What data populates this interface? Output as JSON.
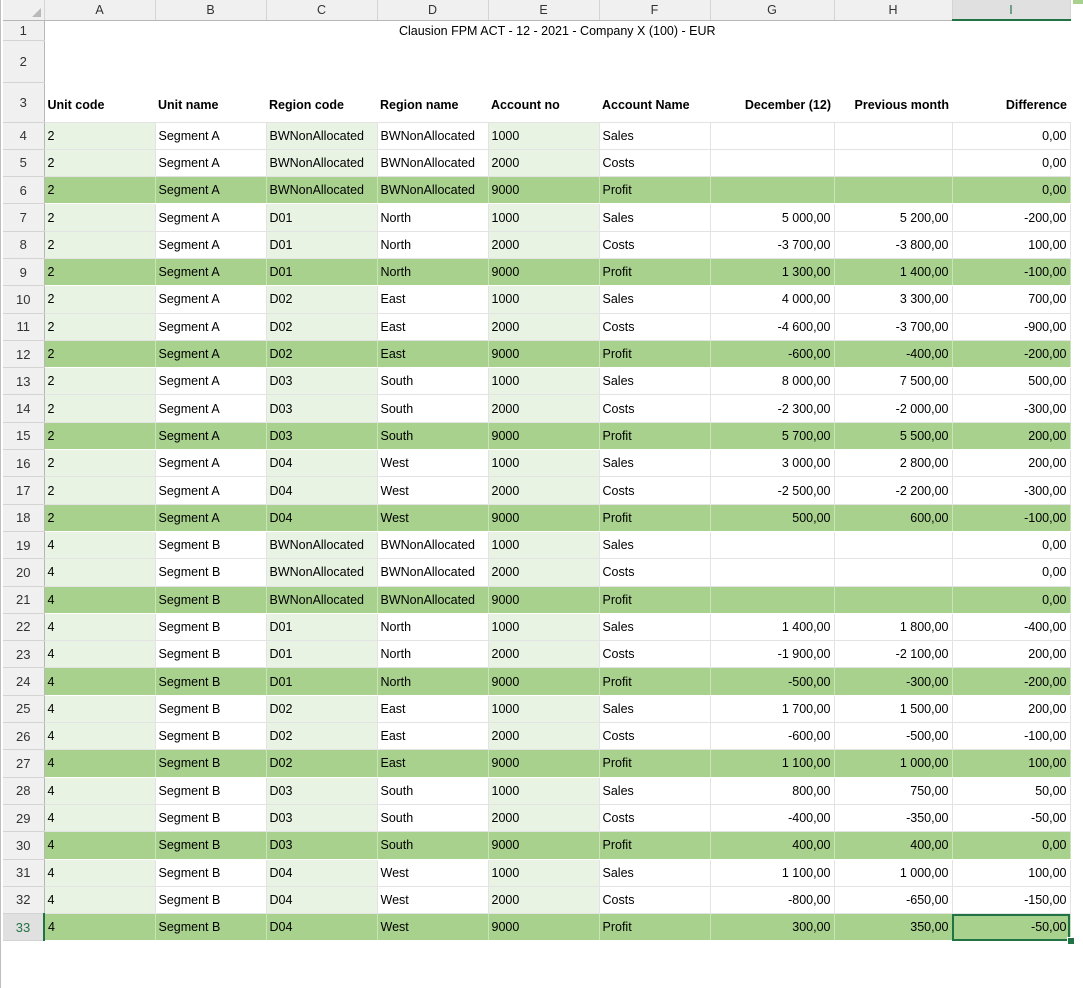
{
  "columns": [
    "A",
    "B",
    "C",
    "D",
    "E",
    "F",
    "G",
    "H",
    "I"
  ],
  "selected_column": "I",
  "selected_row": "33",
  "report_title": "Clausion FPM    ACT - 12 - 2021 - Company X (100) - EUR",
  "headers": {
    "unit_code": "Unit code",
    "unit_name": "Unit name",
    "region_code": "Region code",
    "region_name": "Region name",
    "account_no": "Account no",
    "account_name": "Account Name",
    "current": "December (12)",
    "previous": "Previous month",
    "difference": "Difference"
  },
  "row_numbers": [
    "1",
    "2",
    "3",
    "4",
    "5",
    "6",
    "7",
    "8",
    "9",
    "10",
    "11",
    "12",
    "13",
    "14",
    "15",
    "16",
    "17",
    "18",
    "19",
    "20",
    "21",
    "22",
    "23",
    "24",
    "25",
    "26",
    "27",
    "28",
    "29",
    "30",
    "31",
    "32",
    "33"
  ],
  "rows": [
    {
      "unit_code": "2",
      "unit_name": "Segment A",
      "region_code": "BWNonAllocated",
      "region_name": "BWNonAllocated",
      "account_no": "1000",
      "account_name": "Sales",
      "current": "",
      "previous": "",
      "difference": "0,00"
    },
    {
      "unit_code": "2",
      "unit_name": "Segment A",
      "region_code": "BWNonAllocated",
      "region_name": "BWNonAllocated",
      "account_no": "2000",
      "account_name": "Costs",
      "current": "",
      "previous": "",
      "difference": "0,00"
    },
    {
      "unit_code": "2",
      "unit_name": "Segment A",
      "region_code": "BWNonAllocated",
      "region_name": "BWNonAllocated",
      "account_no": "9000",
      "account_name": "Profit",
      "current": "",
      "previous": "",
      "difference": "0,00"
    },
    {
      "unit_code": "2",
      "unit_name": "Segment A",
      "region_code": "D01",
      "region_name": "North",
      "account_no": "1000",
      "account_name": "Sales",
      "current": "5 000,00",
      "previous": "5 200,00",
      "difference": "-200,00"
    },
    {
      "unit_code": "2",
      "unit_name": "Segment A",
      "region_code": "D01",
      "region_name": "North",
      "account_no": "2000",
      "account_name": "Costs",
      "current": "-3 700,00",
      "previous": "-3 800,00",
      "difference": "100,00"
    },
    {
      "unit_code": "2",
      "unit_name": "Segment A",
      "region_code": "D01",
      "region_name": "North",
      "account_no": "9000",
      "account_name": "Profit",
      "current": "1 300,00",
      "previous": "1 400,00",
      "difference": "-100,00"
    },
    {
      "unit_code": "2",
      "unit_name": "Segment A",
      "region_code": "D02",
      "region_name": "East",
      "account_no": "1000",
      "account_name": "Sales",
      "current": "4 000,00",
      "previous": "3 300,00",
      "difference": "700,00"
    },
    {
      "unit_code": "2",
      "unit_name": "Segment A",
      "region_code": "D02",
      "region_name": "East",
      "account_no": "2000",
      "account_name": "Costs",
      "current": "-4 600,00",
      "previous": "-3 700,00",
      "difference": "-900,00"
    },
    {
      "unit_code": "2",
      "unit_name": "Segment A",
      "region_code": "D02",
      "region_name": "East",
      "account_no": "9000",
      "account_name": "Profit",
      "current": "-600,00",
      "previous": "-400,00",
      "difference": "-200,00"
    },
    {
      "unit_code": "2",
      "unit_name": "Segment A",
      "region_code": "D03",
      "region_name": "South",
      "account_no": "1000",
      "account_name": "Sales",
      "current": "8 000,00",
      "previous": "7 500,00",
      "difference": "500,00"
    },
    {
      "unit_code": "2",
      "unit_name": "Segment A",
      "region_code": "D03",
      "region_name": "South",
      "account_no": "2000",
      "account_name": "Costs",
      "current": "-2 300,00",
      "previous": "-2 000,00",
      "difference": "-300,00"
    },
    {
      "unit_code": "2",
      "unit_name": "Segment A",
      "region_code": "D03",
      "region_name": "South",
      "account_no": "9000",
      "account_name": "Profit",
      "current": "5 700,00",
      "previous": "5 500,00",
      "difference": "200,00"
    },
    {
      "unit_code": "2",
      "unit_name": "Segment A",
      "region_code": "D04",
      "region_name": "West",
      "account_no": "1000",
      "account_name": "Sales",
      "current": "3 000,00",
      "previous": "2 800,00",
      "difference": "200,00"
    },
    {
      "unit_code": "2",
      "unit_name": "Segment A",
      "region_code": "D04",
      "region_name": "West",
      "account_no": "2000",
      "account_name": "Costs",
      "current": "-2 500,00",
      "previous": "-2 200,00",
      "difference": "-300,00"
    },
    {
      "unit_code": "2",
      "unit_name": "Segment A",
      "region_code": "D04",
      "region_name": "West",
      "account_no": "9000",
      "account_name": "Profit",
      "current": "500,00",
      "previous": "600,00",
      "difference": "-100,00"
    },
    {
      "unit_code": "4",
      "unit_name": "Segment B",
      "region_code": "BWNonAllocated",
      "region_name": "BWNonAllocated",
      "account_no": "1000",
      "account_name": "Sales",
      "current": "",
      "previous": "",
      "difference": "0,00"
    },
    {
      "unit_code": "4",
      "unit_name": "Segment B",
      "region_code": "BWNonAllocated",
      "region_name": "BWNonAllocated",
      "account_no": "2000",
      "account_name": "Costs",
      "current": "",
      "previous": "",
      "difference": "0,00"
    },
    {
      "unit_code": "4",
      "unit_name": "Segment B",
      "region_code": "BWNonAllocated",
      "region_name": "BWNonAllocated",
      "account_no": "9000",
      "account_name": "Profit",
      "current": "",
      "previous": "",
      "difference": "0,00"
    },
    {
      "unit_code": "4",
      "unit_name": "Segment B",
      "region_code": "D01",
      "region_name": "North",
      "account_no": "1000",
      "account_name": "Sales",
      "current": "1 400,00",
      "previous": "1 800,00",
      "difference": "-400,00"
    },
    {
      "unit_code": "4",
      "unit_name": "Segment B",
      "region_code": "D01",
      "region_name": "North",
      "account_no": "2000",
      "account_name": "Costs",
      "current": "-1 900,00",
      "previous": "-2 100,00",
      "difference": "200,00"
    },
    {
      "unit_code": "4",
      "unit_name": "Segment B",
      "region_code": "D01",
      "region_name": "North",
      "account_no": "9000",
      "account_name": "Profit",
      "current": "-500,00",
      "previous": "-300,00",
      "difference": "-200,00"
    },
    {
      "unit_code": "4",
      "unit_name": "Segment B",
      "region_code": "D02",
      "region_name": "East",
      "account_no": "1000",
      "account_name": "Sales",
      "current": "1 700,00",
      "previous": "1 500,00",
      "difference": "200,00"
    },
    {
      "unit_code": "4",
      "unit_name": "Segment B",
      "region_code": "D02",
      "region_name": "East",
      "account_no": "2000",
      "account_name": "Costs",
      "current": "-600,00",
      "previous": "-500,00",
      "difference": "-100,00"
    },
    {
      "unit_code": "4",
      "unit_name": "Segment B",
      "region_code": "D02",
      "region_name": "East",
      "account_no": "9000",
      "account_name": "Profit",
      "current": "1 100,00",
      "previous": "1 000,00",
      "difference": "100,00"
    },
    {
      "unit_code": "4",
      "unit_name": "Segment B",
      "region_code": "D03",
      "region_name": "South",
      "account_no": "1000",
      "account_name": "Sales",
      "current": "800,00",
      "previous": "750,00",
      "difference": "50,00"
    },
    {
      "unit_code": "4",
      "unit_name": "Segment B",
      "region_code": "D03",
      "region_name": "South",
      "account_no": "2000",
      "account_name": "Costs",
      "current": "-400,00",
      "previous": "-350,00",
      "difference": "-50,00"
    },
    {
      "unit_code": "4",
      "unit_name": "Segment B",
      "region_code": "D03",
      "region_name": "South",
      "account_no": "9000",
      "account_name": "Profit",
      "current": "400,00",
      "previous": "400,00",
      "difference": "0,00"
    },
    {
      "unit_code": "4",
      "unit_name": "Segment B",
      "region_code": "D04",
      "region_name": "West",
      "account_no": "1000",
      "account_name": "Sales",
      "current": "1 100,00",
      "previous": "1 000,00",
      "difference": "100,00"
    },
    {
      "unit_code": "4",
      "unit_name": "Segment B",
      "region_code": "D04",
      "region_name": "West",
      "account_no": "2000",
      "account_name": "Costs",
      "current": "-800,00",
      "previous": "-650,00",
      "difference": "-150,00"
    },
    {
      "unit_code": "4",
      "unit_name": "Segment B",
      "region_code": "D04",
      "region_name": "West",
      "account_no": "9000",
      "account_name": "Profit",
      "current": "300,00",
      "previous": "350,00",
      "difference": "-50,00"
    }
  ],
  "colors": {
    "profit_row": "#a9d18e",
    "light_green_cell": "#e8f3e4",
    "selection": "#217346",
    "header_bg": "#f0f0f0"
  }
}
